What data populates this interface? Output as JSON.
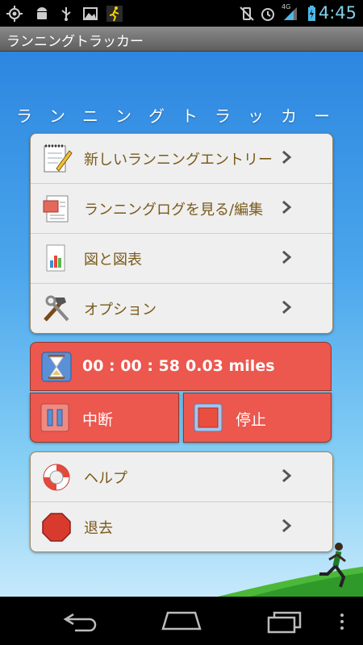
{
  "status_bar": {
    "time": "4:45",
    "network_label": "4G",
    "icons": [
      "gps-icon",
      "android-debug-icon",
      "usb-icon",
      "image-icon",
      "runner-notification-icon",
      "vibrate-icon",
      "alarm-icon",
      "signal-icon",
      "battery-charging-icon"
    ]
  },
  "app": {
    "title": "ランニングトラッカー",
    "banner": "ランニングトラッカー"
  },
  "menu": [
    {
      "label": "新しいランニングエントリー",
      "icon": "notepad-icon"
    },
    {
      "label": "ランニングログを見る/編集",
      "icon": "log-icon"
    },
    {
      "label": "図と図表",
      "icon": "chart-icon"
    },
    {
      "label": "オプション",
      "icon": "tools-icon"
    }
  ],
  "timer": {
    "elapsed": "00 : 00 : 58",
    "distance": "0.03 miles",
    "pause_label": "中断",
    "stop_label": "停止"
  },
  "menu2": [
    {
      "label": "ヘルプ",
      "icon": "lifebuoy-icon"
    },
    {
      "label": "退去",
      "icon": "stop-sign-icon"
    }
  ],
  "colors": {
    "accent_red": "#ec574e",
    "label_brown": "#7a5a1a",
    "sky_top": "#2d86e0"
  }
}
